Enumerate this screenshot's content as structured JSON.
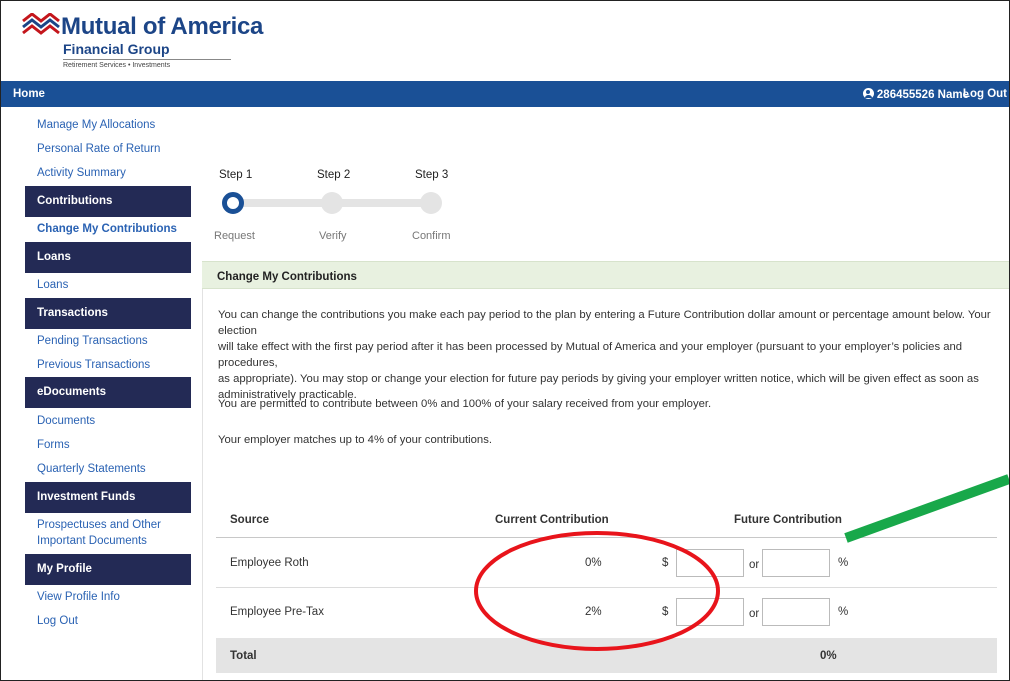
{
  "brand": {
    "name": "Mutual of America",
    "sub": "Financial Group",
    "tagline": "Retirement Services • Investments"
  },
  "topbar": {
    "home": "Home",
    "user": "286455526 Name",
    "logout": "Log Out"
  },
  "sidebar": {
    "links_top": [
      "Manage My Allocations",
      "Personal Rate of Return",
      "Activity Summary"
    ],
    "contributions_head": "Contributions",
    "change_contrib": "Change My Contributions",
    "loans_head": "Loans",
    "loans_link": "Loans",
    "transactions_head": "Transactions",
    "pending": "Pending Transactions",
    "previous": "Previous Transactions",
    "edocs_head": "eDocuments",
    "documents": "Documents",
    "forms": "Forms",
    "quarterly": "Quarterly Statements",
    "funds_head": "Investment Funds",
    "prospectus_1": "Prospectuses and Other",
    "prospectus_2": "Important Documents",
    "profile_head": "My Profile",
    "view_profile": "View Profile Info",
    "logout": "Log Out"
  },
  "stepper": {
    "steps": [
      {
        "label": "Step 1",
        "sub": "Request"
      },
      {
        "label": "Step 2",
        "sub": "Verify"
      },
      {
        "label": "Step 3",
        "sub": "Confirm"
      }
    ]
  },
  "panel": {
    "title": "Change My Contributions",
    "para1_l1": "You can change the contributions you make each pay period to the plan by entering a Future Contribution dollar amount or percentage amount below. Your election",
    "para1_l2": "will take effect with the first pay period after it has been processed by Mutual of America and your employer (pursuant to your employer’s policies and procedures,",
    "para1_l3": "as appropriate). You may stop or change your election for future pay periods by giving your employer written notice, which will be given effect as soon as",
    "para1_l4": "administratively practicable.",
    "para2": "You are permitted to contribute between 0% and 100% of your salary received from your employer.",
    "para3": "Your employer matches up to 4% of your contributions."
  },
  "table": {
    "headers": {
      "source": "Source",
      "current": "Current Contribution",
      "future": "Future Contribution"
    },
    "rows": [
      {
        "source": "Employee Roth",
        "current": "0%",
        "dollar": "$",
        "or": "or",
        "pct": "%"
      },
      {
        "source": "Employee Pre-Tax",
        "current": "2%",
        "dollar": "$",
        "or": "or",
        "pct": "%"
      }
    ],
    "total_label": "Total",
    "total_value": "0%"
  },
  "colors": {
    "topbar": "#1a5096",
    "sidebar_head": "#232a55",
    "link": "#2a62b3",
    "panel_head": "#e8f1e0",
    "annotation_circle": "#e8141b",
    "annotation_arrow": "#18a84a"
  }
}
